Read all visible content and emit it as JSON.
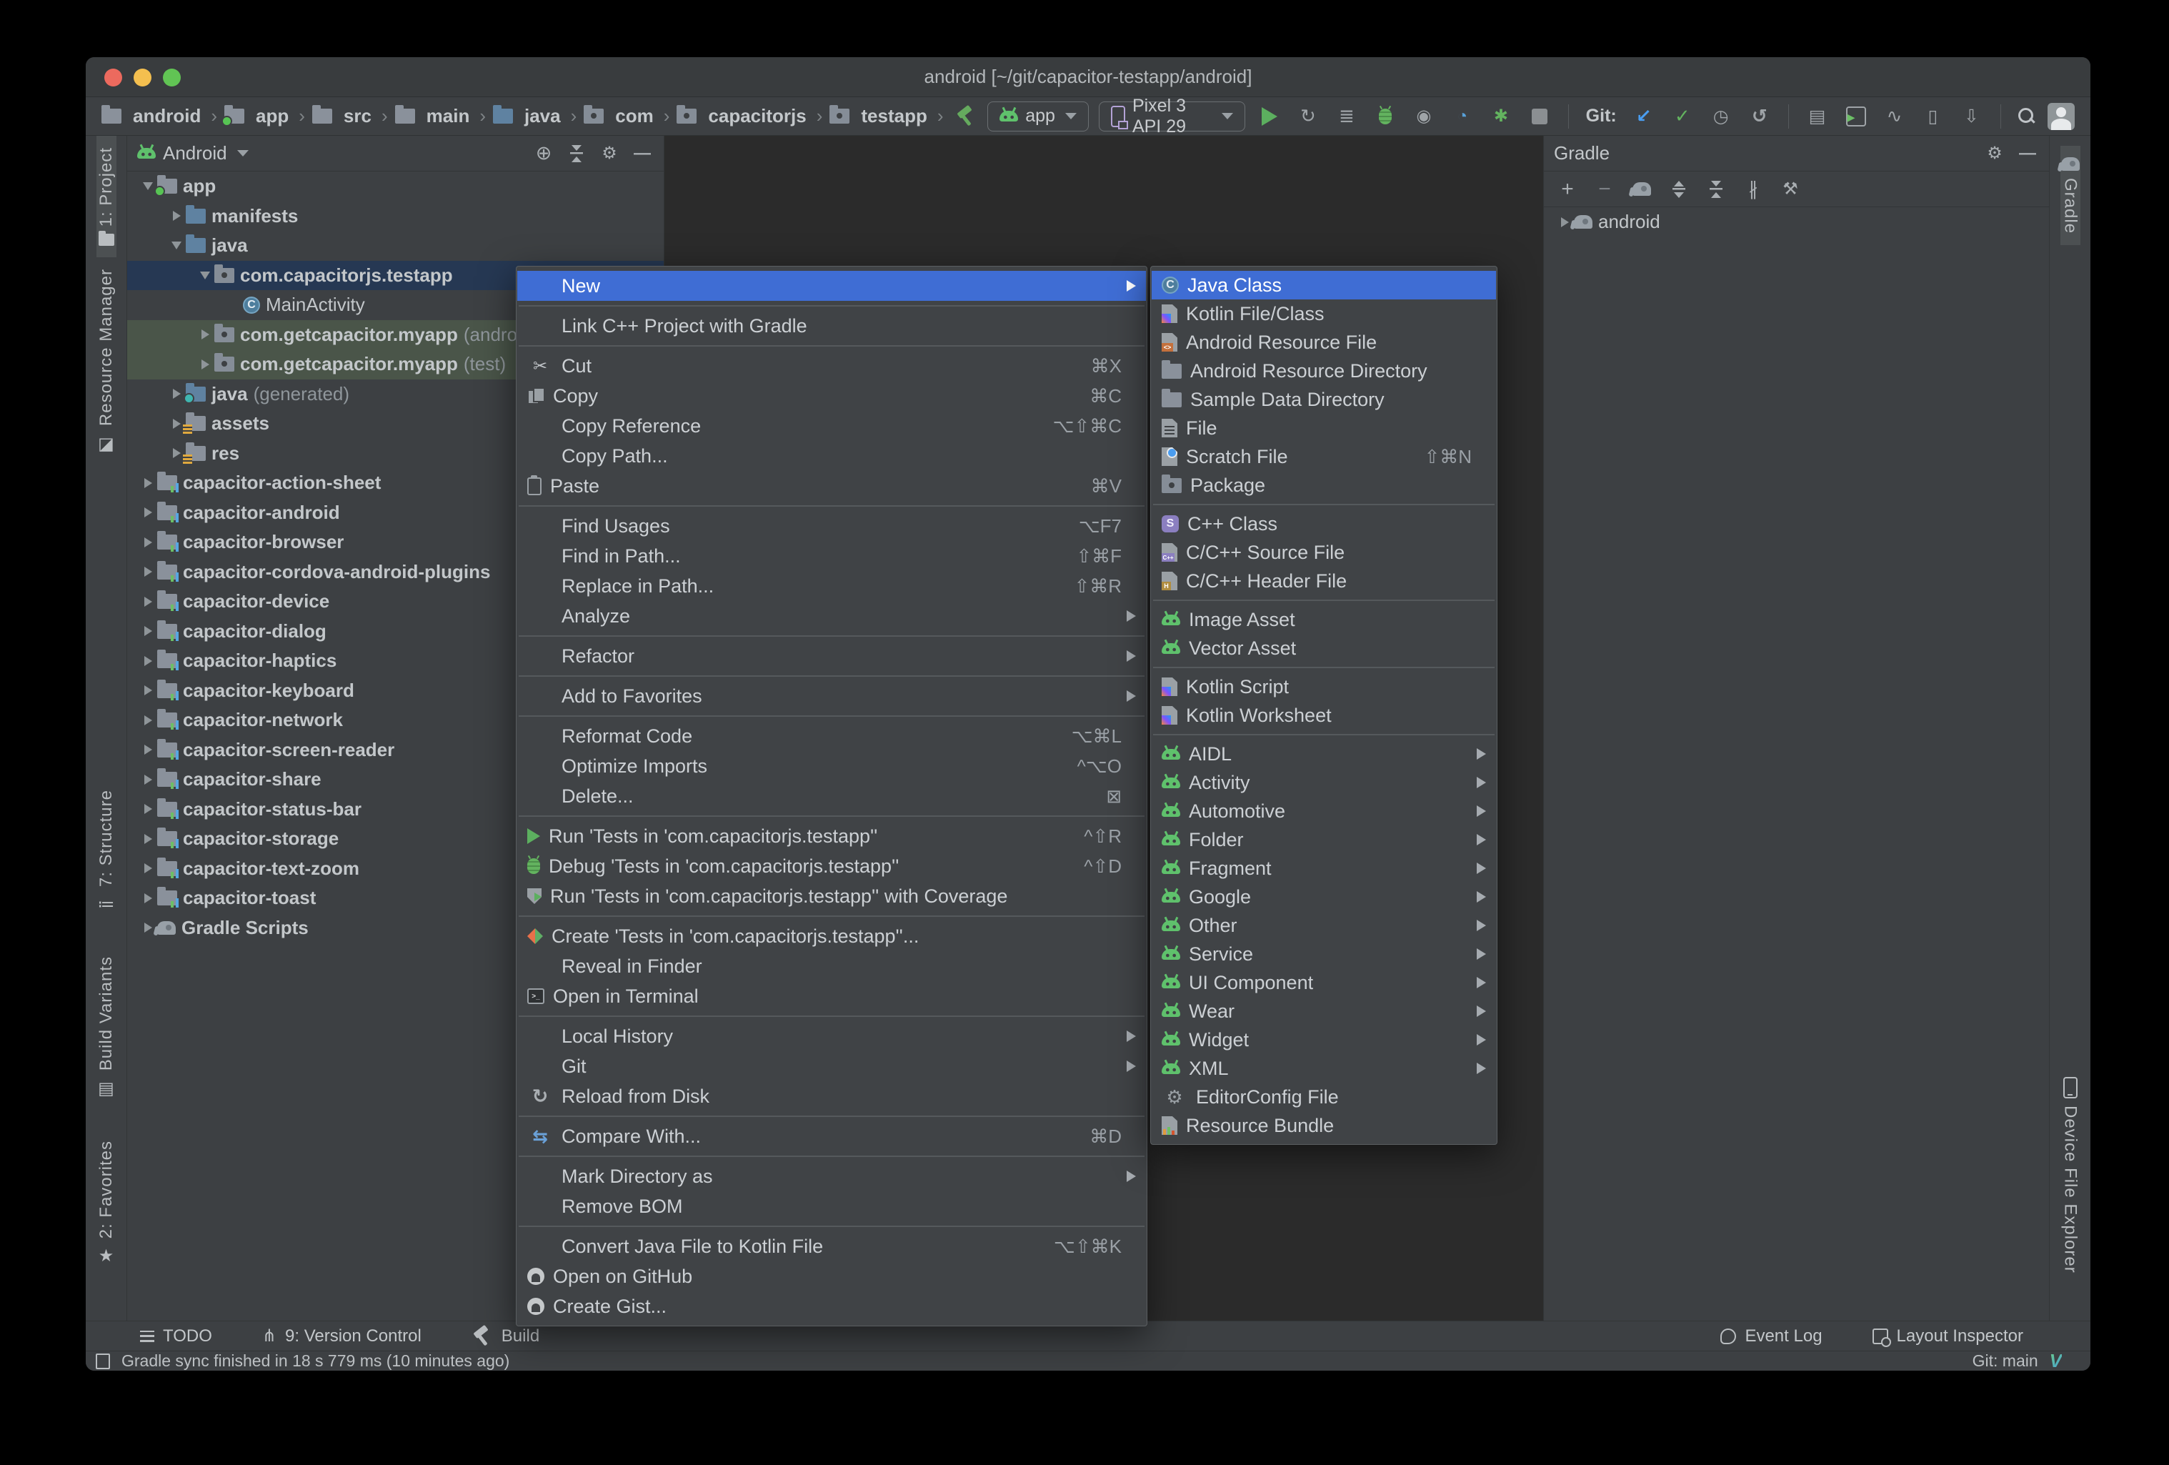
{
  "window": {
    "title": "android [~/git/capacitor-testapp/android]"
  },
  "toolbar": {
    "breadcrumbs": [
      {
        "icon": "folder-gray",
        "label": "android"
      },
      {
        "icon": "folder-app",
        "label": "app"
      },
      {
        "icon": "folder-gray",
        "label": "src"
      },
      {
        "icon": "folder-gray",
        "label": "main"
      },
      {
        "icon": "folder-blue",
        "label": "java"
      },
      {
        "icon": "pkg",
        "label": "com"
      },
      {
        "icon": "pkg",
        "label": "capacitorjs"
      },
      {
        "icon": "pkg",
        "label": "testapp"
      }
    ],
    "run_config": "app",
    "device": "Pixel 3 API 29",
    "git_label": "Git:",
    "run_icons": [
      {
        "icon": "play"
      },
      {
        "icon": "rerun"
      },
      {
        "icon": "runlist"
      },
      {
        "icon": "bug"
      },
      {
        "icon": "attach"
      },
      {
        "icon": "gauge"
      },
      {
        "icon": "profile2"
      },
      {
        "icon": "stop"
      }
    ],
    "git_icons": [
      {
        "icon": "vcs-update"
      },
      {
        "icon": "vcs-commit"
      },
      {
        "icon": "history"
      },
      {
        "icon": "rollback"
      }
    ],
    "tool_icons": [
      {
        "icon": "device-manager"
      },
      {
        "icon": "logcat"
      },
      {
        "icon": "profiler"
      },
      {
        "icon": "avd"
      },
      {
        "icon": "sdk"
      }
    ]
  },
  "left_strip": {
    "top": [
      {
        "icon": "projtab",
        "label": "1: Project",
        "active": true
      },
      {
        "icon": "resmgr",
        "label": "Resource Manager"
      }
    ],
    "bottom": [
      {
        "icon": "structure",
        "label": "7: Structure"
      },
      {
        "icon": "buildvar",
        "label": "Build Variants"
      },
      {
        "icon": "star",
        "label": "2: Favorites"
      }
    ]
  },
  "right_strip": {
    "top": [
      {
        "icon": "gradle",
        "label": "Gradle",
        "active": true
      }
    ],
    "bottom": [
      {
        "icon": "phone",
        "label": "Device File Explorer"
      }
    ]
  },
  "project_panel": {
    "view": "Android",
    "header_icons": [
      {
        "icon": "locate"
      },
      {
        "icon": "collapse"
      },
      {
        "icon": "gear-sm"
      },
      {
        "icon": "minus"
      }
    ],
    "tree": [
      {
        "indent": 0,
        "arrow": "down",
        "icon": "folder-app",
        "label": "app",
        "bold": true
      },
      {
        "indent": 1,
        "arrow": "right",
        "icon": "folder-blue",
        "label": "manifests",
        "bold": true
      },
      {
        "indent": 1,
        "arrow": "down",
        "icon": "folder-blue",
        "label": "java",
        "bold": true
      },
      {
        "indent": 2,
        "arrow": "down",
        "icon": "pkg",
        "label": "com.capacitorjs.testapp",
        "bold": true,
        "state": "selected"
      },
      {
        "indent": 3,
        "icon": "class",
        "label": "MainActivity"
      },
      {
        "indent": 2,
        "arrow": "right",
        "icon": "pkg",
        "label": "com.getcapacitor.myapp",
        "suffix": "(androidTest)",
        "bold": true,
        "state": "green"
      },
      {
        "indent": 2,
        "arrow": "right",
        "icon": "pkg",
        "label": "com.getcapacitor.myapp",
        "suffix": "(test)",
        "bold": true,
        "state": "green"
      },
      {
        "indent": 1,
        "arrow": "right",
        "icon": "folder-gen",
        "label": "java",
        "suffix": "(generated)",
        "bold": true
      },
      {
        "indent": 1,
        "arrow": "right",
        "icon": "folder-assets",
        "label": "assets",
        "bold": true
      },
      {
        "indent": 1,
        "arrow": "right",
        "icon": "folder-assets",
        "label": "res",
        "bold": true
      },
      {
        "indent": 0,
        "arrow": "right",
        "icon": "module",
        "label": "capacitor-action-sheet",
        "bold": true
      },
      {
        "indent": 0,
        "arrow": "right",
        "icon": "module",
        "label": "capacitor-android",
        "bold": true
      },
      {
        "indent": 0,
        "arrow": "right",
        "icon": "module",
        "label": "capacitor-browser",
        "bold": true
      },
      {
        "indent": 0,
        "arrow": "right",
        "icon": "module",
        "label": "capacitor-cordova-android-plugins",
        "bold": true
      },
      {
        "indent": 0,
        "arrow": "right",
        "icon": "module",
        "label": "capacitor-device",
        "bold": true
      },
      {
        "indent": 0,
        "arrow": "right",
        "icon": "module",
        "label": "capacitor-dialog",
        "bold": true
      },
      {
        "indent": 0,
        "arrow": "right",
        "icon": "module",
        "label": "capacitor-haptics",
        "bold": true
      },
      {
        "indent": 0,
        "arrow": "right",
        "icon": "module",
        "label": "capacitor-keyboard",
        "bold": true
      },
      {
        "indent": 0,
        "arrow": "right",
        "icon": "module",
        "label": "capacitor-network",
        "bold": true
      },
      {
        "indent": 0,
        "arrow": "right",
        "icon": "module",
        "label": "capacitor-screen-reader",
        "bold": true
      },
      {
        "indent": 0,
        "arrow": "right",
        "icon": "module",
        "label": "capacitor-share",
        "bold": true
      },
      {
        "indent": 0,
        "arrow": "right",
        "icon": "module",
        "label": "capacitor-status-bar",
        "bold": true
      },
      {
        "indent": 0,
        "arrow": "right",
        "icon": "module",
        "label": "capacitor-storage",
        "bold": true
      },
      {
        "indent": 0,
        "arrow": "right",
        "icon": "module",
        "label": "capacitor-text-zoom",
        "bold": true
      },
      {
        "indent": 0,
        "arrow": "right",
        "icon": "module",
        "label": "capacitor-toast",
        "bold": true
      },
      {
        "indent": 0,
        "arrow": "right",
        "icon": "gradle",
        "label": "Gradle Scripts",
        "bold": true
      }
    ]
  },
  "gradle_panel": {
    "title": "Gradle",
    "header_icons": [
      {
        "icon": "gear-sm"
      },
      {
        "icon": "minus"
      }
    ],
    "toolbar_icons": [
      {
        "icon": "plus"
      },
      {
        "icon": "minus2"
      },
      {
        "icon": "gsync"
      },
      {
        "icon": "expand"
      },
      {
        "icon": "collapse2"
      },
      {
        "icon": "skip"
      },
      {
        "icon": "wrench"
      }
    ],
    "tree": [
      {
        "indent": 0,
        "arrow": "right",
        "icon": "gradle-el",
        "label": "android"
      }
    ]
  },
  "context_menu": {
    "items": [
      {
        "label": "New",
        "arrow": true,
        "selected": true
      },
      {
        "sep": true
      },
      {
        "label": "Link C++ Project with Gradle"
      },
      {
        "sep": true
      },
      {
        "icon": "scissors",
        "label": "Cut",
        "shortcut": "⌘X"
      },
      {
        "icon": "copy",
        "label": "Copy",
        "shortcut": "⌘C"
      },
      {
        "label": "Copy Reference",
        "shortcut": "⌥⇧⌘C"
      },
      {
        "label": "Copy Path..."
      },
      {
        "icon": "paste",
        "label": "Paste",
        "shortcut": "⌘V"
      },
      {
        "sep": true
      },
      {
        "label": "Find Usages",
        "shortcut": "⌥F7"
      },
      {
        "label": "Find in Path...",
        "shortcut": "⇧⌘F"
      },
      {
        "label": "Replace in Path...",
        "shortcut": "⇧⌘R"
      },
      {
        "label": "Analyze",
        "arrow": true
      },
      {
        "sep": true
      },
      {
        "label": "Refactor",
        "arrow": true
      },
      {
        "sep": true
      },
      {
        "label": "Add to Favorites",
        "arrow": true
      },
      {
        "sep": true
      },
      {
        "label": "Reformat Code",
        "shortcut": "⌥⌘L"
      },
      {
        "label": "Optimize Imports",
        "shortcut": "^⌥O"
      },
      {
        "label": "Delete...",
        "shortcut": "⊠"
      },
      {
        "sep": true
      },
      {
        "icon": "run",
        "label": "Run 'Tests in 'com.capacitorjs.testapp''",
        "shortcut": "^⇧R"
      },
      {
        "icon": "debug",
        "label": "Debug 'Tests in 'com.capacitorjs.testapp''",
        "shortcut": "^⇧D"
      },
      {
        "icon": "coverage",
        "label": "Run 'Tests in 'com.capacitorjs.testapp'' with Coverage"
      },
      {
        "sep": true
      },
      {
        "icon": "create-tests",
        "label": "Create 'Tests in 'com.capacitorjs.testapp''..."
      },
      {
        "label": "Reveal in Finder"
      },
      {
        "icon": "terminal",
        "label": "Open in Terminal"
      },
      {
        "sep": true
      },
      {
        "label": "Local History",
        "arrow": true
      },
      {
        "label": "Git",
        "arrow": true
      },
      {
        "icon": "reload",
        "label": "Reload from Disk"
      },
      {
        "sep": true
      },
      {
        "icon": "compare",
        "label": "Compare With...",
        "shortcut": "⌘D"
      },
      {
        "sep": true
      },
      {
        "label": "Mark Directory as",
        "arrow": true
      },
      {
        "label": "Remove BOM"
      },
      {
        "sep": true
      },
      {
        "label": "Convert Java File to Kotlin File",
        "shortcut": "⌥⇧⌘K"
      },
      {
        "icon": "github",
        "label": "Open on GitHub"
      },
      {
        "icon": "github",
        "label": "Create Gist..."
      }
    ]
  },
  "submenu": {
    "items": [
      {
        "icon": "java-class",
        "label": "Java Class",
        "selected": true
      },
      {
        "icon": "kotlin",
        "label": "Kotlin File/Class"
      },
      {
        "icon": "android-res",
        "label": "Android Resource File"
      },
      {
        "icon": "folder-gray",
        "label": "Android Resource Directory"
      },
      {
        "icon": "folder-gray",
        "label": "Sample Data Directory"
      },
      {
        "icon": "file",
        "label": "File"
      },
      {
        "icon": "scratch",
        "label": "Scratch File",
        "shortcut": "⇧⌘N"
      },
      {
        "icon": "pkg",
        "label": "Package"
      },
      {
        "sep": true
      },
      {
        "icon": "cpp-class",
        "label": "C++ Class"
      },
      {
        "icon": "cpp-src",
        "label": "C/C++ Source File"
      },
      {
        "icon": "cpp-hdr",
        "label": "C/C++ Header File"
      },
      {
        "sep": true
      },
      {
        "icon": "droid",
        "label": "Image Asset"
      },
      {
        "icon": "droid",
        "label": "Vector Asset"
      },
      {
        "sep": true
      },
      {
        "icon": "kotlin-script",
        "label": "Kotlin Script"
      },
      {
        "icon": "kotlin-script",
        "label": "Kotlin Worksheet"
      },
      {
        "sep": true
      },
      {
        "icon": "droid",
        "label": "AIDL",
        "arrow": true
      },
      {
        "icon": "droid",
        "label": "Activity",
        "arrow": true
      },
      {
        "icon": "droid",
        "label": "Automotive",
        "arrow": true
      },
      {
        "icon": "droid",
        "label": "Folder",
        "arrow": true
      },
      {
        "icon": "droid",
        "label": "Fragment",
        "arrow": true
      },
      {
        "icon": "droid",
        "label": "Google",
        "arrow": true
      },
      {
        "icon": "droid",
        "label": "Other",
        "arrow": true
      },
      {
        "icon": "droid",
        "label": "Service",
        "arrow": true
      },
      {
        "icon": "droid",
        "label": "UI Component",
        "arrow": true
      },
      {
        "icon": "droid",
        "label": "Wear",
        "arrow": true
      },
      {
        "icon": "droid",
        "label": "Widget",
        "arrow": true
      },
      {
        "icon": "droid",
        "label": "XML",
        "arrow": true
      },
      {
        "icon": "gear",
        "label": "EditorConfig File"
      },
      {
        "icon": "resbundle",
        "label": "Resource Bundle"
      }
    ]
  },
  "bottom_bar": {
    "left": [
      {
        "icon": "todo",
        "label": "TODO"
      },
      {
        "icon": "vcs",
        "label": "9: Version Control"
      },
      {
        "icon": "hammer2",
        "label": "Build"
      }
    ],
    "right": [
      {
        "icon": "eventlog",
        "label": "Event Log"
      },
      {
        "icon": "inspector",
        "label": "Layout Inspector"
      }
    ]
  },
  "status_bar": {
    "message": "Gradle sync finished in 18 s 779 ms (10 minutes ago)",
    "git": "Git: main"
  },
  "colors": {
    "selection_blue": "#3f6dd4",
    "tree_selection": "#263853",
    "tree_test_highlight": "#4a5549",
    "panel_bg": "#3d4043",
    "editor_bg": "#2b2b2b",
    "accent_green": "#5fc16c"
  }
}
